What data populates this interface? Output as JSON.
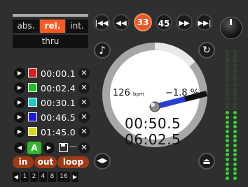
{
  "mode": {
    "buttons": [
      "abs.",
      "rel.",
      "int."
    ],
    "active": "rel.",
    "thru_label": "thru"
  },
  "transport": {
    "buttons": [
      {
        "name": "skip-back-button",
        "icon": "skip-back-icon",
        "label": "⏮"
      },
      {
        "name": "rewind-button",
        "icon": "rewind-icon",
        "label": "◀◀"
      },
      {
        "name": "speed-33-button",
        "label": "33",
        "active": true
      },
      {
        "name": "speed-45-button",
        "label": "45",
        "active": false
      },
      {
        "name": "fast-forward-button",
        "icon": "fast-forward-icon",
        "label": "▶▶"
      },
      {
        "name": "skip-forward-button",
        "icon": "skip-forward-icon",
        "label": "⏭"
      }
    ]
  },
  "cues": [
    {
      "time": "00:00.1",
      "color": "#e01b1b"
    },
    {
      "time": "00:02.4",
      "color": "#1ec21e"
    },
    {
      "time": "00:30.1",
      "color": "#21c8c8"
    },
    {
      "time": "00:46.5",
      "color": "#1a1adf"
    },
    {
      "time": "01:45.0",
      "color": "#d8d81c"
    }
  ],
  "cue_actions": {
    "play_label": "▶",
    "delete_label": "✕"
  },
  "loop": {
    "slot_label": "A",
    "in_label": "in",
    "out_label": "out",
    "loop_label": "loop",
    "beats": [
      "1",
      "2",
      "4",
      "8",
      "16"
    ],
    "dash_label": "—"
  },
  "platter": {
    "bpm_value": "126",
    "bpm_unit": "bpm",
    "pitch": "−1.8 %",
    "elapsed": "00:50.5",
    "total": "06:02.5",
    "position_fraction": 0.14,
    "pitch_color": "#2a3fd0"
  },
  "colors": {
    "accent": "#ff5a1f",
    "meter_green": "#2fd62f",
    "meter_off": "#3a5a3a"
  },
  "meter": {
    "lit_fraction": 0.55
  }
}
